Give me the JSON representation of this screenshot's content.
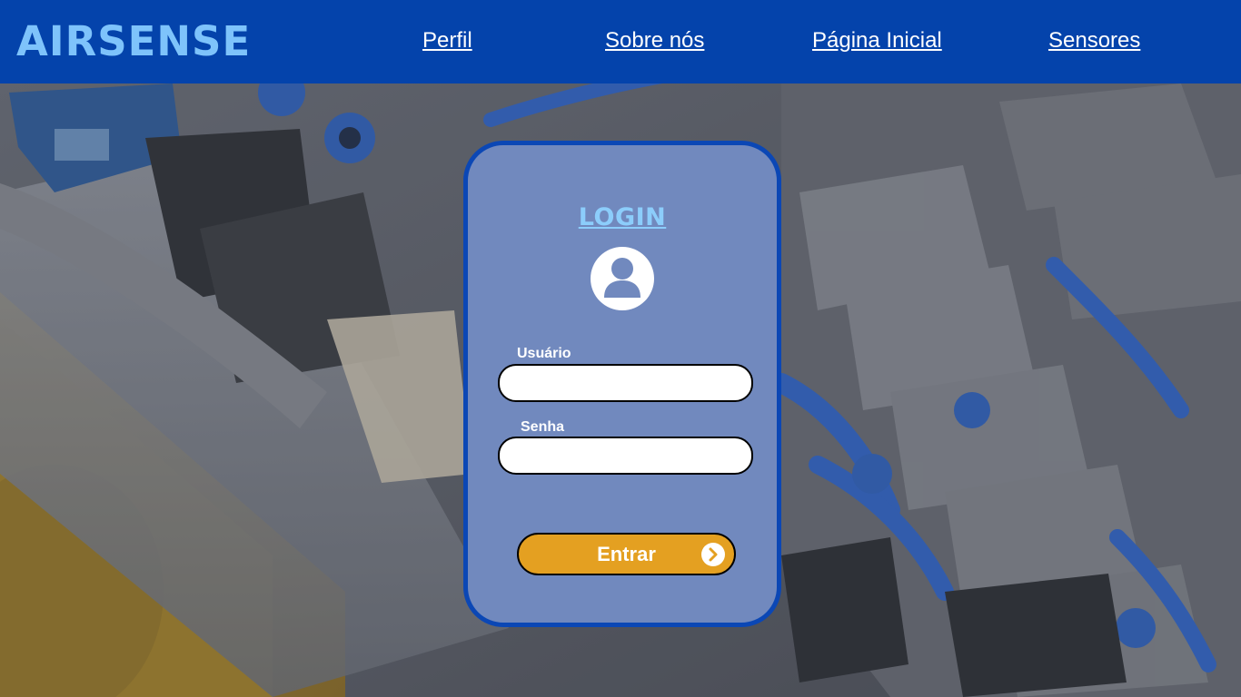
{
  "header": {
    "logo": "AIRSENSE",
    "nav": {
      "perfil": "Perfil",
      "sobre": "Sobre nós",
      "inicio": "Página Inicial",
      "sensores": "Sensores"
    }
  },
  "login": {
    "title": "LOGIN",
    "user_label": "Usuário",
    "user_value": "",
    "pass_label": "Senha",
    "pass_value": "",
    "submit_label": "Entrar"
  },
  "icons": {
    "avatar": "user-avatar-icon",
    "submit": "chevron-right-circle-icon"
  },
  "colors": {
    "header": "#0443ab",
    "logo": "#7ec3fb",
    "card": "#7189be",
    "card_border": "#0b47b5",
    "button": "#e4a021"
  }
}
